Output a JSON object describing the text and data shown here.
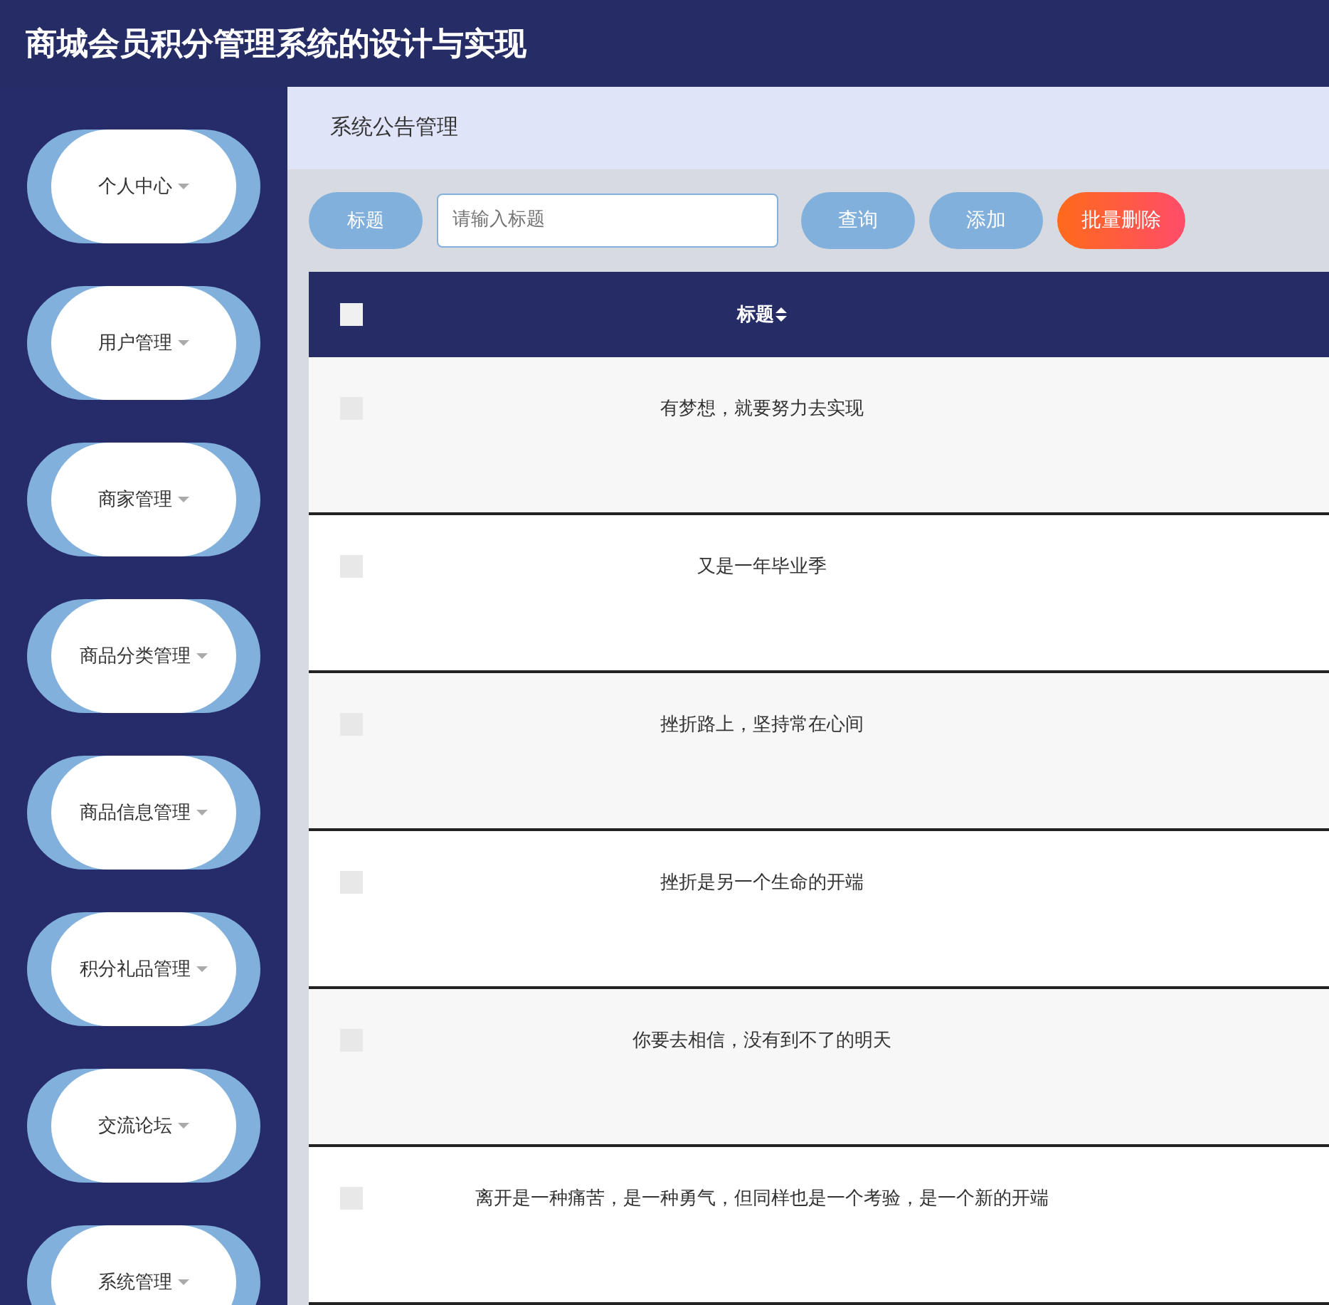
{
  "header": {
    "title": "商城会员积分管理系统的设计与实现"
  },
  "sidebar": {
    "items": [
      {
        "label": "个人中心",
        "expanded": false
      },
      {
        "label": "用户管理",
        "expanded": false
      },
      {
        "label": "商家管理",
        "expanded": false
      },
      {
        "label": "商品分类管理",
        "expanded": false
      },
      {
        "label": "商品信息管理",
        "expanded": false
      },
      {
        "label": "积分礼品管理",
        "expanded": false
      },
      {
        "label": "交流论坛",
        "expanded": false
      },
      {
        "label": "系统管理",
        "expanded": false
      }
    ]
  },
  "breadcrumb": "系统公告管理",
  "search": {
    "label": "标题",
    "placeholder": "请输入标题"
  },
  "buttons": [
    {
      "label": "查询",
      "kind": "normal"
    },
    {
      "label": "添加",
      "kind": "normal"
    },
    {
      "label": "批量删除",
      "kind": "danger"
    }
  ],
  "table": {
    "header_checked": false,
    "columns": [
      "标题"
    ],
    "rows": [
      {
        "title": "有梦想，就要努力去实现",
        "checked": false
      },
      {
        "title": "又是一年毕业季",
        "checked": false
      },
      {
        "title": "挫折路上，坚持常在心间",
        "checked": false
      },
      {
        "title": "挫折是另一个生命的开端",
        "checked": false
      },
      {
        "title": "你要去相信，没有到不了的明天",
        "checked": false
      },
      {
        "title": "离开是一种痛苦，是一种勇气，但同样也是一个考验，是一个新的开端",
        "checked": false
      }
    ]
  }
}
